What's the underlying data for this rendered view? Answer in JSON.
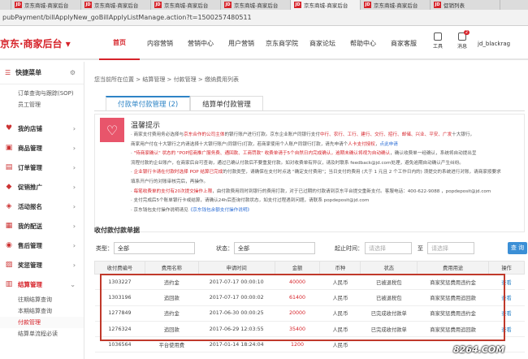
{
  "browser": {
    "tabs": [
      "",
      "京东商城-商家后台",
      "京东商城-商家后台",
      "京东商城-商家后台",
      "京东商城-商家后台",
      "京东商城-商家后台",
      "京东商城-商家后台",
      "促销列表"
    ],
    "url": "pubPayment/billApplyNew_goBillApplyListManage.action?t=1500257480511"
  },
  "header": {
    "logo": "京东·商家后台 ▾",
    "nav": [
      "首页",
      "内容营销",
      "营销中心",
      "用户营销",
      "京东商学院",
      "商家论坛",
      "帮助中心",
      "商家客服"
    ],
    "tools_label": "工具",
    "msg_label": "消息",
    "msg_badge": "2",
    "username": "jd_blackrag"
  },
  "sidebar": {
    "quick_title": "快捷菜单",
    "quick_items": [
      "订单查询与跟踪(SOP)",
      "员工管理"
    ],
    "menus": [
      {
        "label": "我的店铺",
        "icon": "♥"
      },
      {
        "label": "商品管理",
        "icon": "▣"
      },
      {
        "label": "订单管理",
        "icon": "▤"
      },
      {
        "label": "促销推广",
        "icon": "◆"
      },
      {
        "label": "活动报名",
        "icon": "◈"
      },
      {
        "label": "我的配送",
        "icon": "▦"
      },
      {
        "label": "售后管理",
        "icon": "◉"
      },
      {
        "label": "奖惩管理",
        "icon": "▨"
      },
      {
        "label": "结算管理",
        "icon": "▥"
      }
    ],
    "settle_subs": [
      "往期结算查询",
      "本期结算查询",
      "付款管理",
      "结算单流程必读"
    ]
  },
  "main": {
    "breadcrumb": "您当前所在位置 > 结算管理 > 付款管理 > 缴纳费用列表",
    "tabs": [
      "付款单付款管理 (2)",
      "结算单付款管理"
    ],
    "notice_title": "温馨提示",
    "notice_lines": [
      [
        "· 商家支付费用务必选择与",
        "京东合作的公司主体",
        "的银行账户进行打款。京东企业账户同银行支付",
        "中行、农行、工行、建行、交行、招行、邮储、兴业、平安、广发",
        "十大银行，"
      ],
      [
        "  商家用户付在十大银行之内请选择十大银行账户(同银行)打款，若商家使用个人账户同银行打款，请先申请个",
        "人卡支付授权",
        "，",
        "点此申请",
        ""
      ],
      [
        "· ",
        "\"待商家确认\" 状态的 \"POP招商推广服务费、通回款、工商罚款\" 收费单请于5个自然日内完成确认，逾期未确认将视为自动确认",
        "，确认收费单一经确认，系统将自动提出呈",
        "",
        ""
      ],
      [
        "  流程付款的企业账户，在商家后台可查询，通过已确认付款后不要重复付款。如对收费单有异议，请及时联系 feedback@jd.com处理，避免逾期自动确认产生纠纷。",
        "",
        "",
        "",
        ""
      ],
      [
        "· ",
        "企业银行卡请在付款时选择 POP 结算已完成",
        "的付款类型，请确保在支付时点选 \"确定支付费用\"；当日支付的费用 (大于 1 元且 2 个工作日内的) 须提交的系统进行对账，请商家按要求",
        "",
        ""
      ],
      [
        "  填系开户行的对账审核完后，再操作。",
        "",
        "",
        "",
        ""
      ],
      [
        "· ",
        "每笔收费单的支付有20次提交操作上限",
        "，由付款费用同时到银行的费用打款，对于已过期的付款请到京东平台提交重新支付。客服电话：400-622-9088 ，popdeposit@jd.com",
        "",
        ""
      ],
      [
        "· 支付完成后5个账单银行卡或结算，请确认24h后查询付款状态，如支付过程遇到问题，请联系 popdeposit@jd.com",
        "",
        "",
        "",
        ""
      ],
      [
        "· 京东钱包支付操作说明请见",
        "《京东钱包余额支付操作说明》",
        "",
        "",
        ""
      ]
    ],
    "section_title": "收付款付款单据",
    "filters": {
      "type_label": "类型：",
      "type_value": "全部",
      "status_label": "状态：",
      "status_value": "全部",
      "time_label": "起止时间：",
      "start_placeholder": "请选择",
      "to_label": "至",
      "end_placeholder": "请选择",
      "query_label": "查 询"
    },
    "table": {
      "headers": [
        "收付费编号",
        "费用名称",
        "申请时间",
        "金额",
        "币种",
        "状态",
        "费用用途",
        "操作"
      ],
      "rows": [
        [
          "1303227",
          "违约金",
          "2017-07-17 00:00:10",
          "40000",
          "人民币",
          "已被退税包",
          "商家奖惩费用违约金",
          "查看"
        ],
        [
          "1303196",
          "追回款",
          "2017-07-17 00:00:02",
          "61400",
          "人民币",
          "已被退税包",
          "商家奖惩费用追回款",
          "查看"
        ],
        [
          "1277849",
          "违约金",
          "2017-06-30 00:00:25",
          "20000",
          "人民币",
          "已完成收付款单",
          "商家奖惩费用违约金",
          "查看"
        ],
        [
          "1276324",
          "追回款",
          "2017-06-29 12:03:55",
          "35400",
          "人民币",
          "已完成收付款单",
          "商家奖惩费用追回款",
          "查看"
        ],
        [
          "1036564",
          "平台使用费",
          "2017-01-14 18:24:04",
          "1200",
          "人民币",
          "",
          "",
          ""
        ]
      ]
    }
  },
  "watermark": "8264.COM",
  "colors": {
    "brand_red": "#d6232a",
    "link_blue": "#2e84c6",
    "notice_pink": "#e8556b"
  }
}
